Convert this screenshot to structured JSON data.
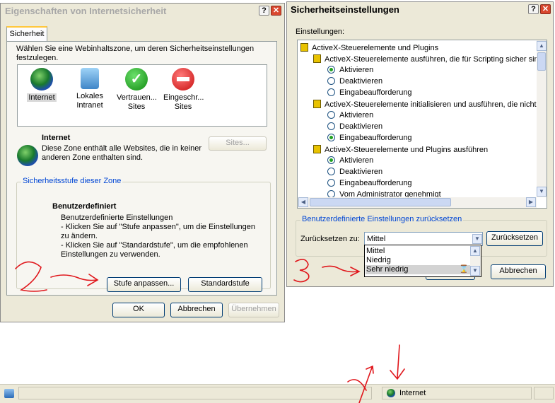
{
  "left_dialog": {
    "title": "Eigenschaften von Internetsicherheit",
    "help_label": "?",
    "close_label": "✕",
    "tab": "Sicherheit",
    "instruction": "Wählen Sie eine Webinhaltszone, um deren Sicherheitseinstellungen festzulegen.",
    "zones": [
      {
        "label": "Internet",
        "icon": "globe-icon"
      },
      {
        "label": "Lokales Intranet",
        "icon": "intranet-icon"
      },
      {
        "label": "Vertrauen... Sites",
        "icon": "check-icon"
      },
      {
        "label": "Eingeschr... Sites",
        "icon": "restricted-icon"
      }
    ],
    "zone_title": "Internet",
    "zone_description": "Diese Zone enthält alle Websites, die in keiner anderen Zone enthalten sind.",
    "sites_button": "Sites...",
    "level_group": "Sicherheitsstufe dieser Zone",
    "level_title": "Benutzerdefiniert",
    "level_text1": "Benutzerdefinierte Einstellungen",
    "level_text2": "- Klicken Sie auf \"Stufe anpassen\", um die Einstellungen zu ändern.",
    "level_text3": "- Klicken Sie auf \"Standardstufe\", um die empfohlenen Einstellungen zu verwenden.",
    "custom_level_button": "Stufe anpassen...",
    "default_level_button": "Standardstufe",
    "ok_button": "OK",
    "cancel_button": "Abbrechen",
    "apply_button": "Übernehmen"
  },
  "right_dialog": {
    "title": "Sicherheitseinstellungen",
    "help_label": "?",
    "close_label": "✕",
    "settings_label": "Einstellungen:",
    "tree": [
      {
        "type": "category",
        "label": "ActiveX-Steuerelemente und Plugins"
      },
      {
        "type": "setting",
        "label": "ActiveX-Steuerelemente ausführen, die für Scripting sicher sind"
      },
      {
        "type": "option",
        "label": "Aktivieren",
        "selected": true
      },
      {
        "type": "option",
        "label": "Deaktivieren",
        "selected": false
      },
      {
        "type": "option",
        "label": "Eingabeaufforderung",
        "selected": false
      },
      {
        "type": "setting",
        "label": "ActiveX-Steuerelemente initialisieren und ausführen, die nicht"
      },
      {
        "type": "option",
        "label": "Aktivieren",
        "selected": false
      },
      {
        "type": "option",
        "label": "Deaktivieren",
        "selected": false
      },
      {
        "type": "option",
        "label": "Eingabeaufforderung",
        "selected": true
      },
      {
        "type": "setting",
        "label": "ActiveX-Steuerelemente und Plugins ausführen"
      },
      {
        "type": "option",
        "label": "Aktivieren",
        "selected": true
      },
      {
        "type": "option",
        "label": "Deaktivieren",
        "selected": false
      },
      {
        "type": "option",
        "label": "Eingabeaufforderung",
        "selected": false
      },
      {
        "type": "option",
        "label": "Vom Administrator genehmigt",
        "selected": false
      }
    ],
    "reset_group": "Benutzerdefinierte Einstellungen zurücksetzen",
    "reset_to_label": "Zurücksetzen zu:",
    "reset_select_value": "Mittel",
    "reset_options": [
      "Mittel",
      "Niedrig",
      "Sehr niedrig"
    ],
    "reset_button": "Zurücksetzen",
    "cancel_button": "Abbrechen"
  },
  "statusbar": {
    "zone_label": "Internet"
  },
  "annotations": {
    "step2": "2",
    "step3": "3"
  },
  "colors": {
    "dialog_bg": "#ece9d8",
    "legend_blue": "#0046d5",
    "annotation_red": "#e0161b",
    "highlight": "#316ac5"
  }
}
